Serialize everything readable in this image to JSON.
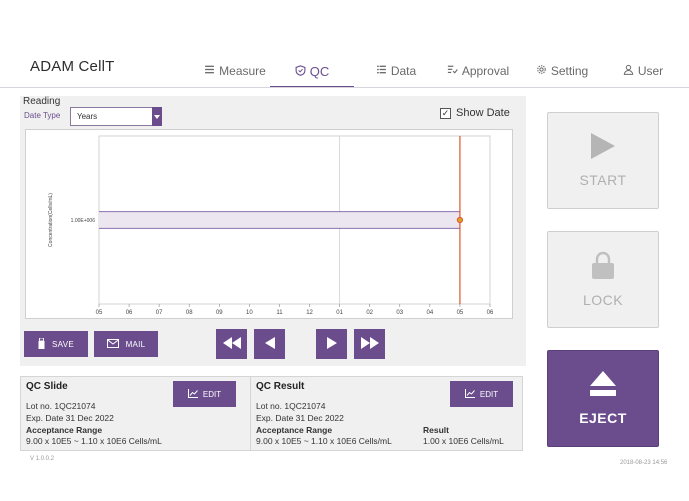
{
  "app": {
    "brand": "ADAM CellT"
  },
  "nav": {
    "items": [
      {
        "label": "Measure",
        "icon": "list-icon"
      },
      {
        "label": "QC",
        "icon": "shield-icon",
        "active": true
      },
      {
        "label": "Data",
        "icon": "list-icon"
      },
      {
        "label": "Approval",
        "icon": "approval-icon"
      },
      {
        "label": "Setting",
        "icon": "gear-icon"
      },
      {
        "label": "User",
        "icon": "user-icon"
      }
    ]
  },
  "reading": {
    "title": "Reading",
    "date_type_label": "Date Type",
    "date_type_value": "Years",
    "show_date_label": "Show Date",
    "show_date_checked": true,
    "show_date_mark": "✓"
  },
  "chart_data": {
    "type": "line",
    "ylabel": "Concentration(Cells/mL)",
    "y_tick": "1.00E+006",
    "x_ticks": [
      "05",
      "06",
      "07",
      "08",
      "09",
      "10",
      "11",
      "12",
      "01",
      "02",
      "03",
      "04",
      "05",
      "06"
    ],
    "acceptance_range": [
      900000,
      1100000
    ],
    "points": [
      {
        "x": "05",
        "y": 1000000
      }
    ],
    "marker_x": "05",
    "colors": {
      "band_fill": "#ece6f1",
      "band_stroke": "#8a6fae",
      "marker": "#d9572b",
      "point": "#e0a020"
    }
  },
  "buttons": {
    "save": "SAVE",
    "mail": "MAIL"
  },
  "qc_slide": {
    "title": "QC Slide",
    "edit": "EDIT",
    "lot": "Lot no. 1QC21074",
    "exp": "Exp. Date 31 Dec 2022",
    "range_label": "Acceptance Range",
    "range_value": "9.00 x 10E5 ~ 1.10 x 10E6 Cells/mL"
  },
  "qc_result": {
    "title": "QC Result",
    "edit": "EDIT",
    "lot": "Lot no. 1QC21074",
    "exp": "Exp. Date 31 Dec 2022",
    "range_label": "Acceptance Range",
    "range_value": "9.00 x 10E5 ~ 1.10 x 10E6 Cells/mL",
    "result_label": "Result",
    "result_value": "1.00 x 10E6 Cells/mL"
  },
  "side": {
    "start": "START",
    "lock": "LOCK",
    "eject": "EJECT"
  },
  "footer": {
    "version": "V 1.0.0.2",
    "timestamp": "2018-08-23 14:56"
  },
  "colors": {
    "accent": "#6b4d8e",
    "panel": "#f0f0f0"
  }
}
